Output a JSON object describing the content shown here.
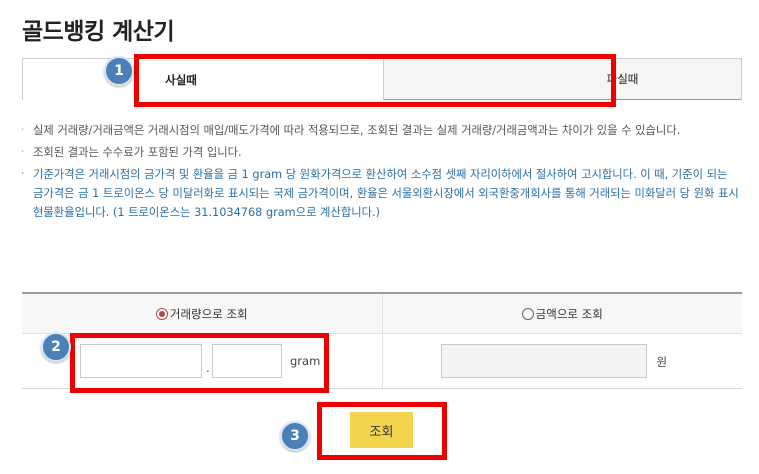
{
  "page": {
    "title": "골드뱅킹 계산기"
  },
  "tabs": [
    {
      "label": "사실때",
      "active": true
    },
    {
      "label": "파실때",
      "active": false
    }
  ],
  "notes": [
    {
      "text": "실제 거래량/거래금액은 거래시점의 매입/매도가격에 따라 적용되므로, 조회된 결과는 실제 거래량/거래금액과는 차이가 있을 수 있습니다.",
      "style": "gray"
    },
    {
      "text": "조회된 결과는 수수료가 포함된 가격 입니다.",
      "style": "gray"
    },
    {
      "text": "기준가격은 거래시점의 금가격 및 환율을 금 1 gram 당 원화가격으로 환산하여 소수점 셋째 자리이하에서 절사하여 고시합니다. 이 때, 기준이 되는 금가격은 금 1 트로이온스 당 미달러화로 표시되는 국제 금가격이며, 환율은 서울외환시장에서 외국환중개회사를 통해 거래되는 미화달러 당 원화 표시 현물환율입니다. (1 트로이온스는 31.1034768 gram으로 계산합니다.)",
      "style": "blue"
    }
  ],
  "search": {
    "options": [
      {
        "label": "거래량으로 조회",
        "checked": true
      },
      {
        "label": "금액으로 조회",
        "checked": false
      }
    ],
    "weight_int": "",
    "separator": ".",
    "weight_dec": "",
    "weight_unit": "gram",
    "amount": "",
    "amount_unit": "원"
  },
  "button": {
    "label": "조회"
  },
  "badges": [
    "1",
    "2",
    "3"
  ],
  "colors": {
    "annotation": "#ee0000",
    "badge": "#4a7fb8",
    "button": "#f2d54c",
    "note_blue": "#2a6fa6"
  }
}
